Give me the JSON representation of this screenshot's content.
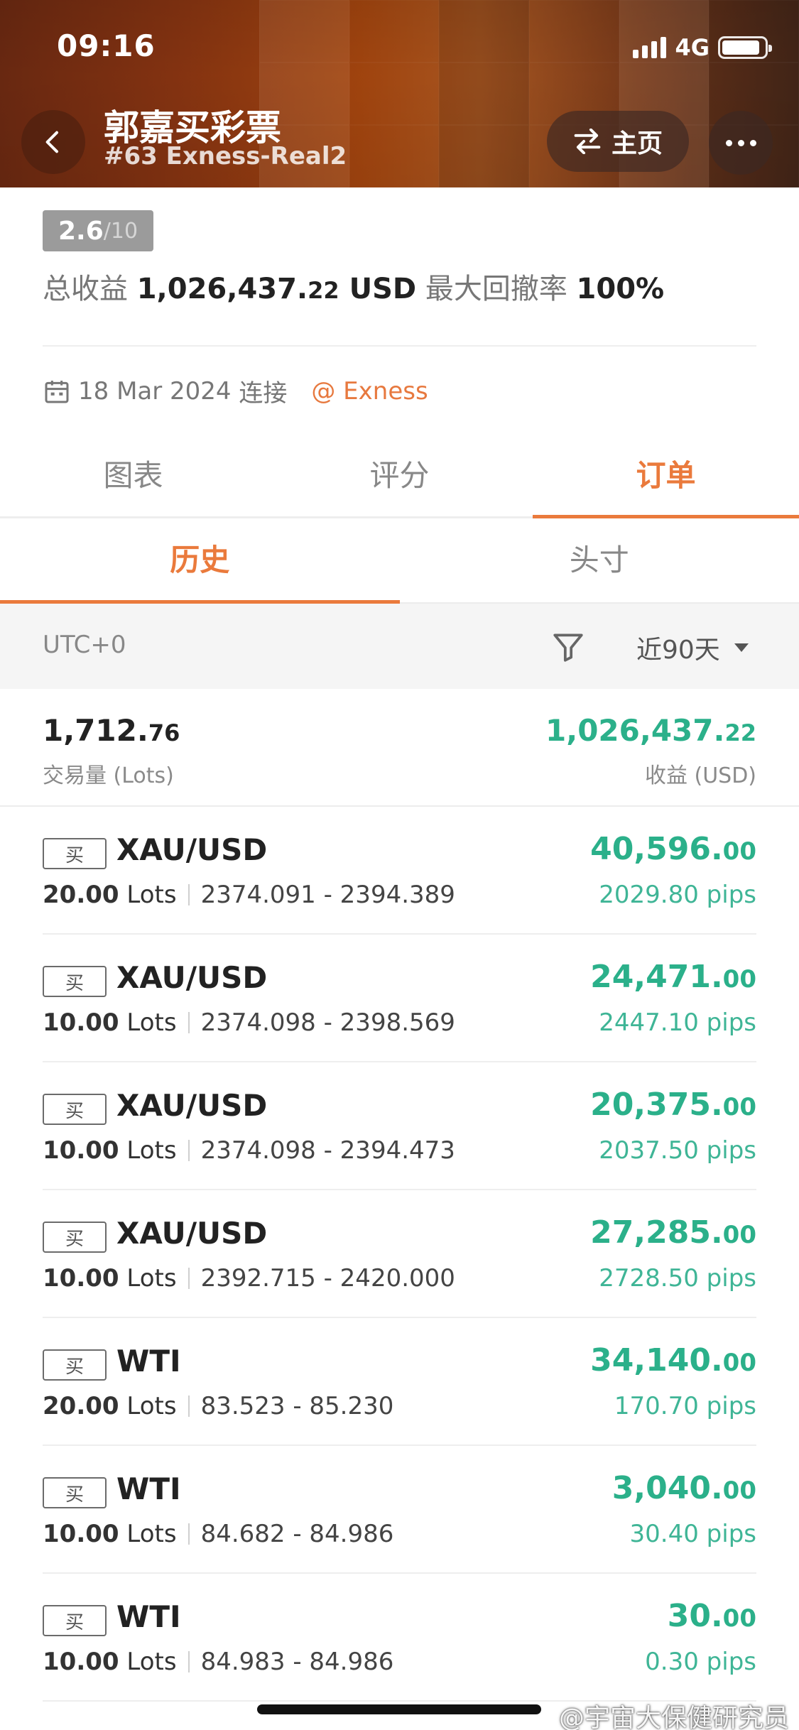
{
  "status_bar": {
    "time": "09:16",
    "network": "4G",
    "battery_level": 0.9
  },
  "header": {
    "title": "郭嘉买彩票",
    "subtitle": "#63 Exness-Real2",
    "home_label": "主页"
  },
  "summary": {
    "score": "2.6",
    "score_max": "/10",
    "profit_label": "总收益",
    "profit_main": "1,026,437.",
    "profit_decimal": "22",
    "profit_unit": "USD",
    "drawdown_label": "最大回撤率",
    "drawdown_value": "100%",
    "connected_date": "18 Mar 2024",
    "connected_label": "连接",
    "broker": "@ Exness"
  },
  "tabs": [
    "图表",
    "评分",
    "订单"
  ],
  "sub_tabs": [
    "历史",
    "头寸"
  ],
  "filter": {
    "timezone": "UTC+0",
    "range": "近90天"
  },
  "totals": {
    "volume_main": "1,712.",
    "volume_decimal": "76",
    "volume_label": "交易量 (Lots)",
    "profit_main": "1,026,437.",
    "profit_decimal": "22",
    "profit_label": "收益 (USD)"
  },
  "orders": [
    {
      "side": "买",
      "symbol": "XAU/USD",
      "lots": "20.00",
      "lots_unit": "Lots",
      "prices": "2374.091 - 2394.389",
      "pnl_main": "40,596.",
      "pnl_decimal": "00",
      "pips": "2029.80 pips"
    },
    {
      "side": "买",
      "symbol": "XAU/USD",
      "lots": "10.00",
      "lots_unit": "Lots",
      "prices": "2374.098 - 2398.569",
      "pnl_main": "24,471.",
      "pnl_decimal": "00",
      "pips": "2447.10 pips"
    },
    {
      "side": "买",
      "symbol": "XAU/USD",
      "lots": "10.00",
      "lots_unit": "Lots",
      "prices": "2374.098 - 2394.473",
      "pnl_main": "20,375.",
      "pnl_decimal": "00",
      "pips": "2037.50 pips"
    },
    {
      "side": "买",
      "symbol": "XAU/USD",
      "lots": "10.00",
      "lots_unit": "Lots",
      "prices": "2392.715 - 2420.000",
      "pnl_main": "27,285.",
      "pnl_decimal": "00",
      "pips": "2728.50 pips"
    },
    {
      "side": "买",
      "symbol": "WTI",
      "lots": "20.00",
      "lots_unit": "Lots",
      "prices": "83.523 - 85.230",
      "pnl_main": "34,140.",
      "pnl_decimal": "00",
      "pips": "170.70 pips"
    },
    {
      "side": "买",
      "symbol": "WTI",
      "lots": "10.00",
      "lots_unit": "Lots",
      "prices": "84.682 - 84.986",
      "pnl_main": "3,040.",
      "pnl_decimal": "00",
      "pips": "30.40 pips"
    },
    {
      "side": "买",
      "symbol": "WTI",
      "lots": "10.00",
      "lots_unit": "Lots",
      "prices": "84.983 - 84.986",
      "pnl_main": "30.",
      "pnl_decimal": "00",
      "pips": "0.30 pips"
    }
  ],
  "watermark": "@宇宙大保健研究员",
  "colors": {
    "accent": "#ea7a3c",
    "profit": "#2bb08a"
  }
}
